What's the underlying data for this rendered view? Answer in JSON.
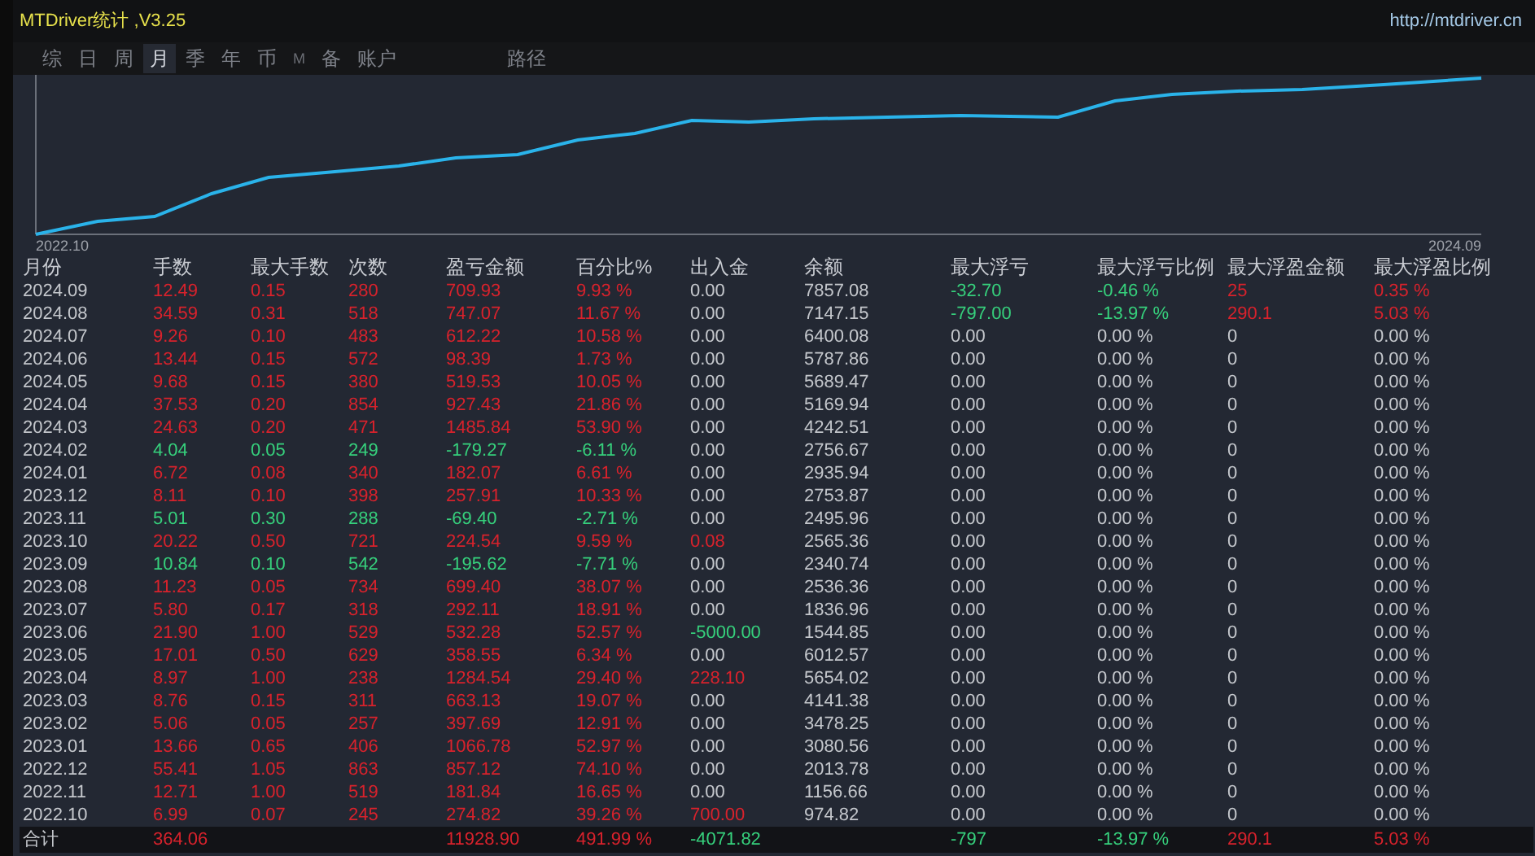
{
  "window": {
    "title": "MTDriver统计 ,V3.25",
    "url": "http://mtdriver.cn"
  },
  "tabs": [
    {
      "label": "综",
      "selected": false,
      "kind": "tab"
    },
    {
      "label": "日",
      "selected": false,
      "kind": "tab"
    },
    {
      "label": "周",
      "selected": false,
      "kind": "tab"
    },
    {
      "label": "月",
      "selected": true,
      "kind": "tab"
    },
    {
      "label": "季",
      "selected": false,
      "kind": "tab"
    },
    {
      "label": "年",
      "selected": false,
      "kind": "tab"
    },
    {
      "label": "币",
      "selected": false,
      "kind": "tab"
    },
    {
      "label": "M",
      "selected": false,
      "kind": "dim"
    },
    {
      "label": "备",
      "selected": false,
      "kind": "tab"
    },
    {
      "label": "账户",
      "selected": false,
      "kind": "tab"
    },
    {
      "label": "路径",
      "selected": false,
      "kind": "detached"
    }
  ],
  "equity_chart": {
    "start_label": "2022.10",
    "end_label": "2024.09"
  },
  "table": {
    "columns": [
      "月份",
      "手数",
      "最大手数",
      "次数",
      "盈亏金额",
      "百分比%",
      "出入金",
      "余额",
      "最大浮亏",
      "最大浮亏比例",
      "最大浮盈金额",
      "最大浮盈比例"
    ],
    "rows": [
      {
        "cells": [
          {
            "text": "2024.09"
          },
          {
            "text": "12.49",
            "color": "#d8222c"
          },
          {
            "text": "0.15",
            "color": "#d8222c"
          },
          {
            "text": "280",
            "color": "#d8222c"
          },
          {
            "text": "709.93",
            "color": "#d8222c"
          },
          {
            "text": "9.93 %",
            "color": "#d8222c"
          },
          {
            "text": "0.00"
          },
          {
            "text": "7857.08"
          },
          {
            "text": "-32.70",
            "color": "#36d07c"
          },
          {
            "text": "-0.46 %",
            "color": "#36d07c"
          },
          {
            "text": "25",
            "color": "#d8222c"
          },
          {
            "text": "0.35 %",
            "color": "#d8222c"
          }
        ]
      },
      {
        "cells": [
          {
            "text": "2024.08"
          },
          {
            "text": "34.59",
            "color": "#d8222c"
          },
          {
            "text": "0.31",
            "color": "#d8222c"
          },
          {
            "text": "518",
            "color": "#d8222c"
          },
          {
            "text": "747.07",
            "color": "#d8222c"
          },
          {
            "text": "11.67 %",
            "color": "#d8222c"
          },
          {
            "text": "0.00"
          },
          {
            "text": "7147.15"
          },
          {
            "text": "-797.00",
            "color": "#36d07c"
          },
          {
            "text": "-13.97 %",
            "color": "#36d07c"
          },
          {
            "text": "290.1",
            "color": "#d8222c"
          },
          {
            "text": "5.03 %",
            "color": "#d8222c"
          }
        ]
      },
      {
        "cells": [
          {
            "text": "2024.07"
          },
          {
            "text": "9.26",
            "color": "#d8222c"
          },
          {
            "text": "0.10",
            "color": "#d8222c"
          },
          {
            "text": "483",
            "color": "#d8222c"
          },
          {
            "text": "612.22",
            "color": "#d8222c"
          },
          {
            "text": "10.58 %",
            "color": "#d8222c"
          },
          {
            "text": "0.00"
          },
          {
            "text": "6400.08"
          },
          {
            "text": "0.00"
          },
          {
            "text": "0.00 %"
          },
          {
            "text": "0"
          },
          {
            "text": "0.00 %"
          }
        ]
      },
      {
        "cells": [
          {
            "text": "2024.06"
          },
          {
            "text": "13.44",
            "color": "#d8222c"
          },
          {
            "text": "0.15",
            "color": "#d8222c"
          },
          {
            "text": "572",
            "color": "#d8222c"
          },
          {
            "text": "98.39",
            "color": "#d8222c"
          },
          {
            "text": "1.73 %",
            "color": "#d8222c"
          },
          {
            "text": "0.00"
          },
          {
            "text": "5787.86"
          },
          {
            "text": "0.00"
          },
          {
            "text": "0.00 %"
          },
          {
            "text": "0"
          },
          {
            "text": "0.00 %"
          }
        ]
      },
      {
        "cells": [
          {
            "text": "2024.05"
          },
          {
            "text": "9.68",
            "color": "#d8222c"
          },
          {
            "text": "0.15",
            "color": "#d8222c"
          },
          {
            "text": "380",
            "color": "#d8222c"
          },
          {
            "text": "519.53",
            "color": "#d8222c"
          },
          {
            "text": "10.05 %",
            "color": "#d8222c"
          },
          {
            "text": "0.00"
          },
          {
            "text": "5689.47"
          },
          {
            "text": "0.00"
          },
          {
            "text": "0.00 %"
          },
          {
            "text": "0"
          },
          {
            "text": "0.00 %"
          }
        ]
      },
      {
        "cells": [
          {
            "text": "2024.04"
          },
          {
            "text": "37.53",
            "color": "#d8222c"
          },
          {
            "text": "0.20",
            "color": "#d8222c"
          },
          {
            "text": "854",
            "color": "#d8222c"
          },
          {
            "text": "927.43",
            "color": "#d8222c"
          },
          {
            "text": "21.86 %",
            "color": "#d8222c"
          },
          {
            "text": "0.00"
          },
          {
            "text": "5169.94"
          },
          {
            "text": "0.00"
          },
          {
            "text": "0.00 %"
          },
          {
            "text": "0"
          },
          {
            "text": "0.00 %"
          }
        ]
      },
      {
        "cells": [
          {
            "text": "2024.03"
          },
          {
            "text": "24.63",
            "color": "#d8222c"
          },
          {
            "text": "0.20",
            "color": "#d8222c"
          },
          {
            "text": "471",
            "color": "#d8222c"
          },
          {
            "text": "1485.84",
            "color": "#d8222c"
          },
          {
            "text": "53.90 %",
            "color": "#d8222c"
          },
          {
            "text": "0.00"
          },
          {
            "text": "4242.51"
          },
          {
            "text": "0.00"
          },
          {
            "text": "0.00 %"
          },
          {
            "text": "0"
          },
          {
            "text": "0.00 %"
          }
        ]
      },
      {
        "cells": [
          {
            "text": "2024.02"
          },
          {
            "text": "4.04",
            "color": "#36d07c"
          },
          {
            "text": "0.05",
            "color": "#36d07c"
          },
          {
            "text": "249",
            "color": "#36d07c"
          },
          {
            "text": "-179.27",
            "color": "#36d07c"
          },
          {
            "text": "-6.11 %",
            "color": "#36d07c"
          },
          {
            "text": "0.00"
          },
          {
            "text": "2756.67"
          },
          {
            "text": "0.00"
          },
          {
            "text": "0.00 %"
          },
          {
            "text": "0"
          },
          {
            "text": "0.00 %"
          }
        ]
      },
      {
        "cells": [
          {
            "text": "2024.01"
          },
          {
            "text": "6.72",
            "color": "#d8222c"
          },
          {
            "text": "0.08",
            "color": "#d8222c"
          },
          {
            "text": "340",
            "color": "#d8222c"
          },
          {
            "text": "182.07",
            "color": "#d8222c"
          },
          {
            "text": "6.61 %",
            "color": "#d8222c"
          },
          {
            "text": "0.00"
          },
          {
            "text": "2935.94"
          },
          {
            "text": "0.00"
          },
          {
            "text": "0.00 %"
          },
          {
            "text": "0"
          },
          {
            "text": "0.00 %"
          }
        ]
      },
      {
        "cells": [
          {
            "text": "2023.12"
          },
          {
            "text": "8.11",
            "color": "#d8222c"
          },
          {
            "text": "0.10",
            "color": "#d8222c"
          },
          {
            "text": "398",
            "color": "#d8222c"
          },
          {
            "text": "257.91",
            "color": "#d8222c"
          },
          {
            "text": "10.33 %",
            "color": "#d8222c"
          },
          {
            "text": "0.00"
          },
          {
            "text": "2753.87"
          },
          {
            "text": "0.00"
          },
          {
            "text": "0.00 %"
          },
          {
            "text": "0"
          },
          {
            "text": "0.00 %"
          }
        ]
      },
      {
        "cells": [
          {
            "text": "2023.11"
          },
          {
            "text": "5.01",
            "color": "#36d07c"
          },
          {
            "text": "0.30",
            "color": "#36d07c"
          },
          {
            "text": "288",
            "color": "#36d07c"
          },
          {
            "text": "-69.40",
            "color": "#36d07c"
          },
          {
            "text": "-2.71 %",
            "color": "#36d07c"
          },
          {
            "text": "0.00"
          },
          {
            "text": "2495.96"
          },
          {
            "text": "0.00"
          },
          {
            "text": "0.00 %"
          },
          {
            "text": "0"
          },
          {
            "text": "0.00 %"
          }
        ]
      },
      {
        "cells": [
          {
            "text": "2023.10"
          },
          {
            "text": "20.22",
            "color": "#d8222c"
          },
          {
            "text": "0.50",
            "color": "#d8222c"
          },
          {
            "text": "721",
            "color": "#d8222c"
          },
          {
            "text": "224.54",
            "color": "#d8222c"
          },
          {
            "text": "9.59 %",
            "color": "#d8222c"
          },
          {
            "text": "0.08",
            "color": "#d8222c"
          },
          {
            "text": "2565.36"
          },
          {
            "text": "0.00"
          },
          {
            "text": "0.00 %"
          },
          {
            "text": "0"
          },
          {
            "text": "0.00 %"
          }
        ]
      },
      {
        "cells": [
          {
            "text": "2023.09"
          },
          {
            "text": "10.84",
            "color": "#36d07c"
          },
          {
            "text": "0.10",
            "color": "#36d07c"
          },
          {
            "text": "542",
            "color": "#36d07c"
          },
          {
            "text": "-195.62",
            "color": "#36d07c"
          },
          {
            "text": "-7.71 %",
            "color": "#36d07c"
          },
          {
            "text": "0.00"
          },
          {
            "text": "2340.74"
          },
          {
            "text": "0.00"
          },
          {
            "text": "0.00 %"
          },
          {
            "text": "0"
          },
          {
            "text": "0.00 %"
          }
        ]
      },
      {
        "cells": [
          {
            "text": "2023.08"
          },
          {
            "text": "11.23",
            "color": "#d8222c"
          },
          {
            "text": "0.05",
            "color": "#d8222c"
          },
          {
            "text": "734",
            "color": "#d8222c"
          },
          {
            "text": "699.40",
            "color": "#d8222c"
          },
          {
            "text": "38.07 %",
            "color": "#d8222c"
          },
          {
            "text": "0.00"
          },
          {
            "text": "2536.36"
          },
          {
            "text": "0.00"
          },
          {
            "text": "0.00 %"
          },
          {
            "text": "0"
          },
          {
            "text": "0.00 %"
          }
        ]
      },
      {
        "cells": [
          {
            "text": "2023.07"
          },
          {
            "text": "5.80",
            "color": "#d8222c"
          },
          {
            "text": "0.17",
            "color": "#d8222c"
          },
          {
            "text": "318",
            "color": "#d8222c"
          },
          {
            "text": "292.11",
            "color": "#d8222c"
          },
          {
            "text": "18.91 %",
            "color": "#d8222c"
          },
          {
            "text": "0.00"
          },
          {
            "text": "1836.96"
          },
          {
            "text": "0.00"
          },
          {
            "text": "0.00 %"
          },
          {
            "text": "0"
          },
          {
            "text": "0.00 %"
          }
        ]
      },
      {
        "cells": [
          {
            "text": "2023.06"
          },
          {
            "text": "21.90",
            "color": "#d8222c"
          },
          {
            "text": "1.00",
            "color": "#d8222c"
          },
          {
            "text": "529",
            "color": "#d8222c"
          },
          {
            "text": "532.28",
            "color": "#d8222c"
          },
          {
            "text": "52.57 %",
            "color": "#d8222c"
          },
          {
            "text": "-5000.00",
            "color": "#36d07c"
          },
          {
            "text": "1544.85"
          },
          {
            "text": "0.00"
          },
          {
            "text": "0.00 %"
          },
          {
            "text": "0"
          },
          {
            "text": "0.00 %"
          }
        ]
      },
      {
        "cells": [
          {
            "text": "2023.05"
          },
          {
            "text": "17.01",
            "color": "#d8222c"
          },
          {
            "text": "0.50",
            "color": "#d8222c"
          },
          {
            "text": "629",
            "color": "#d8222c"
          },
          {
            "text": "358.55",
            "color": "#d8222c"
          },
          {
            "text": "6.34 %",
            "color": "#d8222c"
          },
          {
            "text": "0.00"
          },
          {
            "text": "6012.57"
          },
          {
            "text": "0.00"
          },
          {
            "text": "0.00 %"
          },
          {
            "text": "0"
          },
          {
            "text": "0.00 %"
          }
        ]
      },
      {
        "cells": [
          {
            "text": "2023.04"
          },
          {
            "text": "8.97",
            "color": "#d8222c"
          },
          {
            "text": "1.00",
            "color": "#d8222c"
          },
          {
            "text": "238",
            "color": "#d8222c"
          },
          {
            "text": "1284.54",
            "color": "#d8222c"
          },
          {
            "text": "29.40 %",
            "color": "#d8222c"
          },
          {
            "text": "228.10",
            "color": "#d8222c"
          },
          {
            "text": "5654.02"
          },
          {
            "text": "0.00"
          },
          {
            "text": "0.00 %"
          },
          {
            "text": "0"
          },
          {
            "text": "0.00 %"
          }
        ]
      },
      {
        "cells": [
          {
            "text": "2023.03"
          },
          {
            "text": "8.76",
            "color": "#d8222c"
          },
          {
            "text": "0.15",
            "color": "#d8222c"
          },
          {
            "text": "311",
            "color": "#d8222c"
          },
          {
            "text": "663.13",
            "color": "#d8222c"
          },
          {
            "text": "19.07 %",
            "color": "#d8222c"
          },
          {
            "text": "0.00"
          },
          {
            "text": "4141.38"
          },
          {
            "text": "0.00"
          },
          {
            "text": "0.00 %"
          },
          {
            "text": "0"
          },
          {
            "text": "0.00 %"
          }
        ]
      },
      {
        "cells": [
          {
            "text": "2023.02"
          },
          {
            "text": "5.06",
            "color": "#d8222c"
          },
          {
            "text": "0.05",
            "color": "#d8222c"
          },
          {
            "text": "257",
            "color": "#d8222c"
          },
          {
            "text": "397.69",
            "color": "#d8222c"
          },
          {
            "text": "12.91 %",
            "color": "#d8222c"
          },
          {
            "text": "0.00"
          },
          {
            "text": "3478.25"
          },
          {
            "text": "0.00"
          },
          {
            "text": "0.00 %"
          },
          {
            "text": "0"
          },
          {
            "text": "0.00 %"
          }
        ]
      },
      {
        "cells": [
          {
            "text": "2023.01"
          },
          {
            "text": "13.66",
            "color": "#d8222c"
          },
          {
            "text": "0.65",
            "color": "#d8222c"
          },
          {
            "text": "406",
            "color": "#d8222c"
          },
          {
            "text": "1066.78",
            "color": "#d8222c"
          },
          {
            "text": "52.97 %",
            "color": "#d8222c"
          },
          {
            "text": "0.00"
          },
          {
            "text": "3080.56"
          },
          {
            "text": "0.00"
          },
          {
            "text": "0.00 %"
          },
          {
            "text": "0"
          },
          {
            "text": "0.00 %"
          }
        ]
      },
      {
        "cells": [
          {
            "text": "2022.12"
          },
          {
            "text": "55.41",
            "color": "#d8222c"
          },
          {
            "text": "1.05",
            "color": "#d8222c"
          },
          {
            "text": "863",
            "color": "#d8222c"
          },
          {
            "text": "857.12",
            "color": "#d8222c"
          },
          {
            "text": "74.10 %",
            "color": "#d8222c"
          },
          {
            "text": "0.00"
          },
          {
            "text": "2013.78"
          },
          {
            "text": "0.00"
          },
          {
            "text": "0.00 %"
          },
          {
            "text": "0"
          },
          {
            "text": "0.00 %"
          }
        ]
      },
      {
        "cells": [
          {
            "text": "2022.11"
          },
          {
            "text": "12.71",
            "color": "#d8222c"
          },
          {
            "text": "1.00",
            "color": "#d8222c"
          },
          {
            "text": "519",
            "color": "#d8222c"
          },
          {
            "text": "181.84",
            "color": "#d8222c"
          },
          {
            "text": "16.65 %",
            "color": "#d8222c"
          },
          {
            "text": "0.00"
          },
          {
            "text": "1156.66"
          },
          {
            "text": "0.00"
          },
          {
            "text": "0.00 %"
          },
          {
            "text": "0"
          },
          {
            "text": "0.00 %"
          }
        ]
      },
      {
        "cells": [
          {
            "text": "2022.10"
          },
          {
            "text": "6.99",
            "color": "#d8222c"
          },
          {
            "text": "0.07",
            "color": "#d8222c"
          },
          {
            "text": "245",
            "color": "#d8222c"
          },
          {
            "text": "274.82",
            "color": "#d8222c"
          },
          {
            "text": "39.26 %",
            "color": "#d8222c"
          },
          {
            "text": "700.00",
            "color": "#d8222c"
          },
          {
            "text": "974.82"
          },
          {
            "text": "0.00"
          },
          {
            "text": "0.00 %"
          },
          {
            "text": "0"
          },
          {
            "text": "0.00 %"
          }
        ]
      }
    ],
    "total": {
      "label": {
        "text": "合计"
      },
      "lots": {
        "text": "364.06",
        "color": "#d8222c"
      },
      "profit": {
        "text": "11928.90",
        "color": "#d8222c"
      },
      "percent": {
        "text": "491.99 %",
        "color": "#d8222c"
      },
      "deposits": {
        "text": "-4071.82",
        "color": "#36d07c"
      },
      "max_float_loss": {
        "text": "-797",
        "color": "#36d07c"
      },
      "max_float_loss_pct": {
        "text": "-13.97 %",
        "color": "#36d07c"
      },
      "max_float_profit": {
        "text": "290.1",
        "color": "#d8222c"
      },
      "max_float_profit_pct": {
        "text": "5.03 %",
        "color": "#d8222c"
      }
    }
  }
}
